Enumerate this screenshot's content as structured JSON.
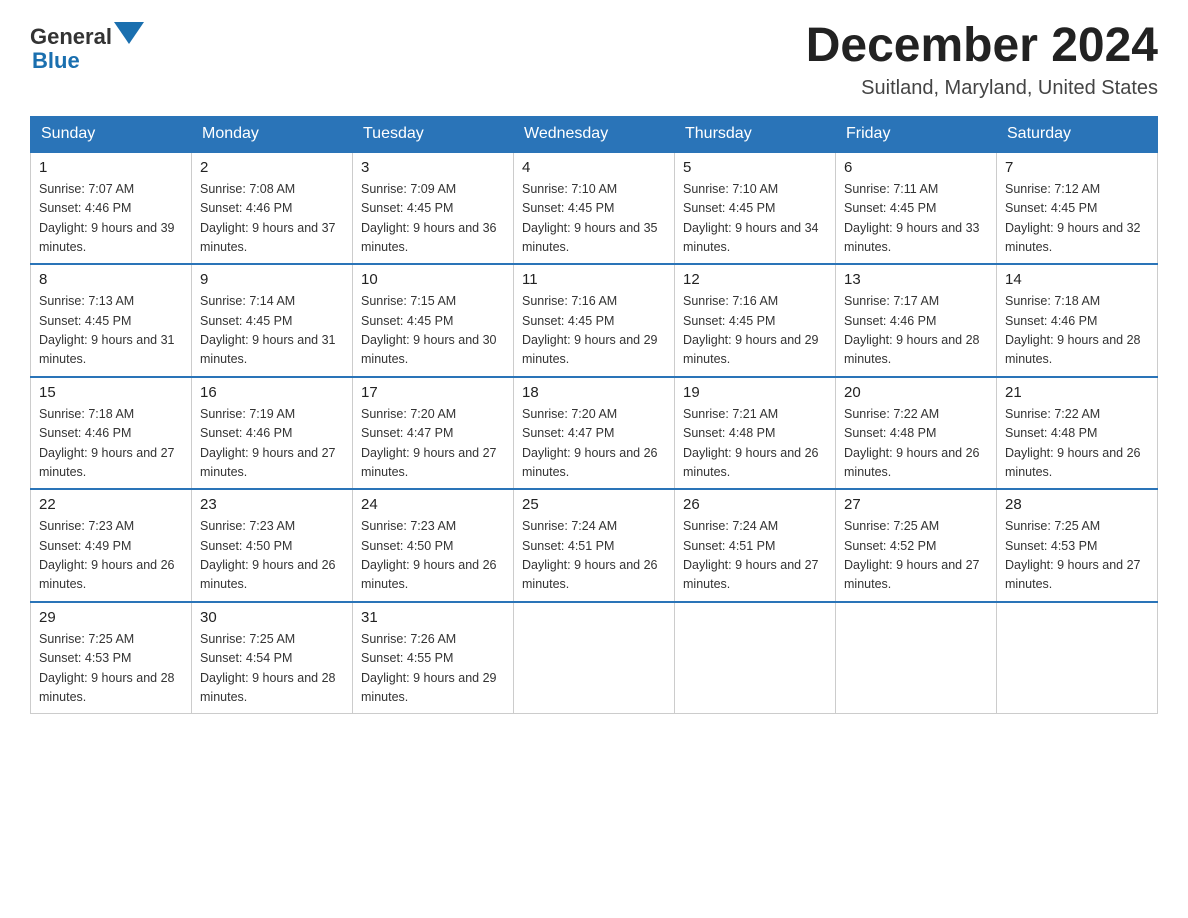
{
  "header": {
    "logo_general": "General",
    "logo_blue": "Blue",
    "title": "December 2024",
    "subtitle": "Suitland, Maryland, United States"
  },
  "days_of_week": [
    "Sunday",
    "Monday",
    "Tuesday",
    "Wednesday",
    "Thursday",
    "Friday",
    "Saturday"
  ],
  "weeks": [
    [
      {
        "day": "1",
        "sunrise": "7:07 AM",
        "sunset": "4:46 PM",
        "daylight": "9 hours and 39 minutes."
      },
      {
        "day": "2",
        "sunrise": "7:08 AM",
        "sunset": "4:46 PM",
        "daylight": "9 hours and 37 minutes."
      },
      {
        "day": "3",
        "sunrise": "7:09 AM",
        "sunset": "4:45 PM",
        "daylight": "9 hours and 36 minutes."
      },
      {
        "day": "4",
        "sunrise": "7:10 AM",
        "sunset": "4:45 PM",
        "daylight": "9 hours and 35 minutes."
      },
      {
        "day": "5",
        "sunrise": "7:10 AM",
        "sunset": "4:45 PM",
        "daylight": "9 hours and 34 minutes."
      },
      {
        "day": "6",
        "sunrise": "7:11 AM",
        "sunset": "4:45 PM",
        "daylight": "9 hours and 33 minutes."
      },
      {
        "day": "7",
        "sunrise": "7:12 AM",
        "sunset": "4:45 PM",
        "daylight": "9 hours and 32 minutes."
      }
    ],
    [
      {
        "day": "8",
        "sunrise": "7:13 AM",
        "sunset": "4:45 PM",
        "daylight": "9 hours and 31 minutes."
      },
      {
        "day": "9",
        "sunrise": "7:14 AM",
        "sunset": "4:45 PM",
        "daylight": "9 hours and 31 minutes."
      },
      {
        "day": "10",
        "sunrise": "7:15 AM",
        "sunset": "4:45 PM",
        "daylight": "9 hours and 30 minutes."
      },
      {
        "day": "11",
        "sunrise": "7:16 AM",
        "sunset": "4:45 PM",
        "daylight": "9 hours and 29 minutes."
      },
      {
        "day": "12",
        "sunrise": "7:16 AM",
        "sunset": "4:45 PM",
        "daylight": "9 hours and 29 minutes."
      },
      {
        "day": "13",
        "sunrise": "7:17 AM",
        "sunset": "4:46 PM",
        "daylight": "9 hours and 28 minutes."
      },
      {
        "day": "14",
        "sunrise": "7:18 AM",
        "sunset": "4:46 PM",
        "daylight": "9 hours and 28 minutes."
      }
    ],
    [
      {
        "day": "15",
        "sunrise": "7:18 AM",
        "sunset": "4:46 PM",
        "daylight": "9 hours and 27 minutes."
      },
      {
        "day": "16",
        "sunrise": "7:19 AM",
        "sunset": "4:46 PM",
        "daylight": "9 hours and 27 minutes."
      },
      {
        "day": "17",
        "sunrise": "7:20 AM",
        "sunset": "4:47 PM",
        "daylight": "9 hours and 27 minutes."
      },
      {
        "day": "18",
        "sunrise": "7:20 AM",
        "sunset": "4:47 PM",
        "daylight": "9 hours and 26 minutes."
      },
      {
        "day": "19",
        "sunrise": "7:21 AM",
        "sunset": "4:48 PM",
        "daylight": "9 hours and 26 minutes."
      },
      {
        "day": "20",
        "sunrise": "7:22 AM",
        "sunset": "4:48 PM",
        "daylight": "9 hours and 26 minutes."
      },
      {
        "day": "21",
        "sunrise": "7:22 AM",
        "sunset": "4:48 PM",
        "daylight": "9 hours and 26 minutes."
      }
    ],
    [
      {
        "day": "22",
        "sunrise": "7:23 AM",
        "sunset": "4:49 PM",
        "daylight": "9 hours and 26 minutes."
      },
      {
        "day": "23",
        "sunrise": "7:23 AM",
        "sunset": "4:50 PM",
        "daylight": "9 hours and 26 minutes."
      },
      {
        "day": "24",
        "sunrise": "7:23 AM",
        "sunset": "4:50 PM",
        "daylight": "9 hours and 26 minutes."
      },
      {
        "day": "25",
        "sunrise": "7:24 AM",
        "sunset": "4:51 PM",
        "daylight": "9 hours and 26 minutes."
      },
      {
        "day": "26",
        "sunrise": "7:24 AM",
        "sunset": "4:51 PM",
        "daylight": "9 hours and 27 minutes."
      },
      {
        "day": "27",
        "sunrise": "7:25 AM",
        "sunset": "4:52 PM",
        "daylight": "9 hours and 27 minutes."
      },
      {
        "day": "28",
        "sunrise": "7:25 AM",
        "sunset": "4:53 PM",
        "daylight": "9 hours and 27 minutes."
      }
    ],
    [
      {
        "day": "29",
        "sunrise": "7:25 AM",
        "sunset": "4:53 PM",
        "daylight": "9 hours and 28 minutes."
      },
      {
        "day": "30",
        "sunrise": "7:25 AM",
        "sunset": "4:54 PM",
        "daylight": "9 hours and 28 minutes."
      },
      {
        "day": "31",
        "sunrise": "7:26 AM",
        "sunset": "4:55 PM",
        "daylight": "9 hours and 29 minutes."
      },
      null,
      null,
      null,
      null
    ]
  ]
}
